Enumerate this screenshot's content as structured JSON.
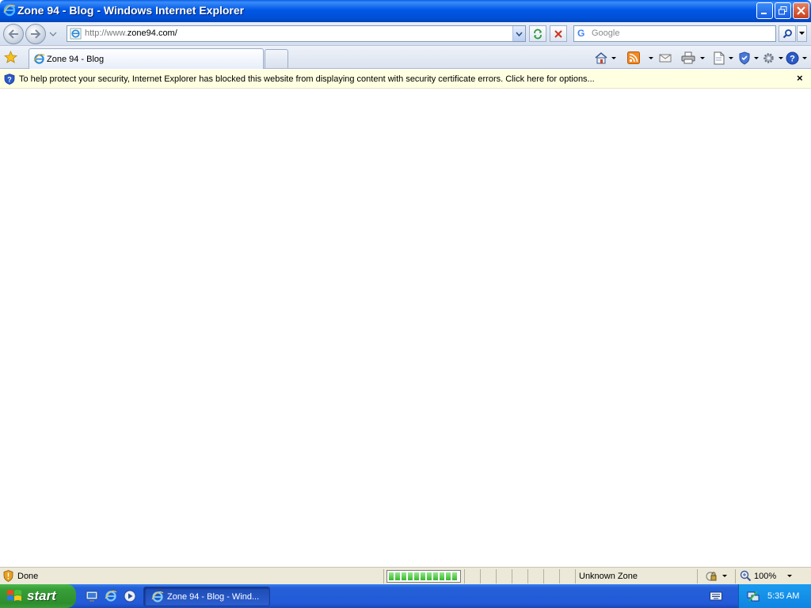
{
  "window": {
    "title": "Zone 94 - Blog - Windows Internet Explorer"
  },
  "address": {
    "url_prefix": "http://www.",
    "url_host": "zone94.com/"
  },
  "search": {
    "placeholder": "Google"
  },
  "tabs": [
    {
      "label": "Zone 94 - Blog",
      "active": true
    }
  ],
  "infobar": {
    "message": "To help protect your security, Internet Explorer has blocked this website from displaying content with security certificate errors. Click here for options...",
    "close": "×"
  },
  "status": {
    "text": "Done",
    "zone": "Unknown Zone",
    "zoom": "100%",
    "progress": 1.0
  },
  "taskbar": {
    "start": "start",
    "task_label": "Zone 94 - Blog - Wind...",
    "clock": "5:35 AM"
  },
  "colors": {
    "titlebar": "#0058e6",
    "infobar_bg": "#ffffe1",
    "start_green": "#38a038",
    "taskbar_blue": "#245ad8"
  }
}
